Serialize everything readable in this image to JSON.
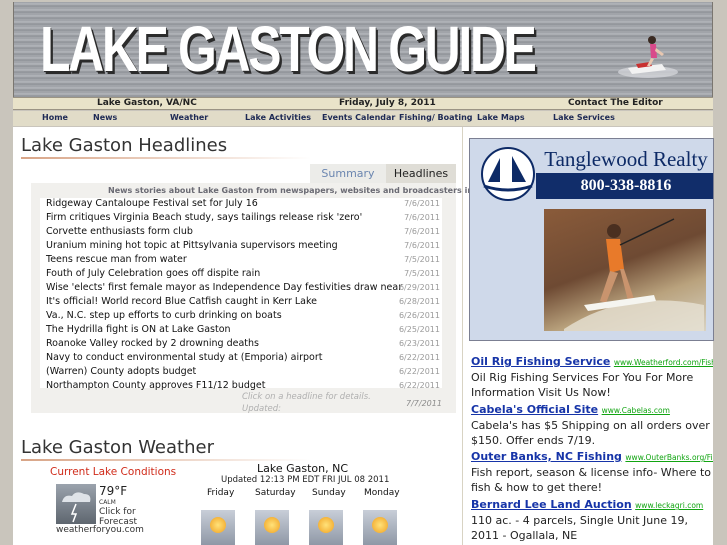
{
  "site": {
    "title": "LAKE GASTON GUIDE",
    "location": "Lake Gaston, VA/NC",
    "date": "Friday, July 8, 2011",
    "contact": "Contact The Editor"
  },
  "nav": [
    "Home",
    "News",
    "Weather",
    "Lake Activities",
    "Events Calendar",
    "Fishing/ Boating",
    "Lake Maps",
    "Lake Services"
  ],
  "headlines": {
    "heading": "Lake Gaston Headlines",
    "tabs": {
      "summary": "Summary",
      "headlines": "Headlines"
    },
    "description": "News stories about Lake Gaston from newspapers, websites and broadcasters in the area.",
    "items": [
      {
        "title": "Ridgeway Cantaloupe Festival set for July 16",
        "date": "7/6/2011"
      },
      {
        "title": "Firm critiques Virginia Beach study, says tailings release risk 'zero'",
        "date": "7/6/2011"
      },
      {
        "title": "Corvette enthusiasts form club",
        "date": "7/6/2011"
      },
      {
        "title": "Uranium mining hot topic at Pittsylvania supervisors meeting",
        "date": "7/6/2011"
      },
      {
        "title": "Teens rescue man from water",
        "date": "7/5/2011"
      },
      {
        "title": "Fouth of July Celebration goes off dispite rain",
        "date": "7/5/2011"
      },
      {
        "title": "Wise 'elects' first female mayor as Independence Day festivities draw near",
        "date": "6/29/2011"
      },
      {
        "title": "It's official! World record Blue Catfish caught in Kerr Lake",
        "date": "6/28/2011"
      },
      {
        "title": "Va., N.C. step up efforts to curb drinking on boats",
        "date": "6/26/2011"
      },
      {
        "title": "The Hydrilla fight is ON at Lake Gaston",
        "date": "6/25/2011"
      },
      {
        "title": "Roanoke Valley rocked by 2 drowning deaths",
        "date": "6/23/2011"
      },
      {
        "title": "Navy to conduct environmental study at (Emporia) airport",
        "date": "6/22/2011"
      },
      {
        "title": "(Warren) County adopts budget",
        "date": "6/22/2011"
      },
      {
        "title": "Northampton County approves F11/12 budget",
        "date": "6/22/2011"
      }
    ],
    "footer_hint": "Click on a headline for details.",
    "updated_label": "Updated:",
    "updated_date": "7/7/2011"
  },
  "weather": {
    "heading": "Lake Gaston Weather",
    "current_title": "Current Lake Conditions",
    "temp": "79°F",
    "wind": "CALM",
    "click_text": "Click for Forecast",
    "source": "weatherforyou.com",
    "forecast_place": "Lake Gaston, NC",
    "forecast_updated": "Updated 12:13 PM EDT FRI JUL 08 2011",
    "days": [
      "Friday",
      "Saturday",
      "Sunday",
      "Monday"
    ]
  },
  "ad": {
    "name": "Tanglewood Realty",
    "phone": "800-338-8816"
  },
  "sponsored": [
    {
      "title": "Oil Rig Fishing Service",
      "url": "www.Weatherford.com/FishingServic",
      "body": "Oil Rig Fishing Services For You For More Information Visit Us Now!"
    },
    {
      "title": "Cabela's Official Site",
      "url": "www.Cabelas.com",
      "body": "Cabela's has $5 Shipping on all orders over $150. Offer ends 7/19."
    },
    {
      "title": "Outer Banks, NC Fishing",
      "url": "www.OuterBanks.org/Fishing",
      "body": "Fish report, season & license info- Where to fish & how to get there!"
    },
    {
      "title": "Bernard Lee Land Auction",
      "url": "www.leckagri.com",
      "body": "110 ac. - 4 parcels, Single Unit June 19, 2011 - Ogallala, NE"
    }
  ]
}
